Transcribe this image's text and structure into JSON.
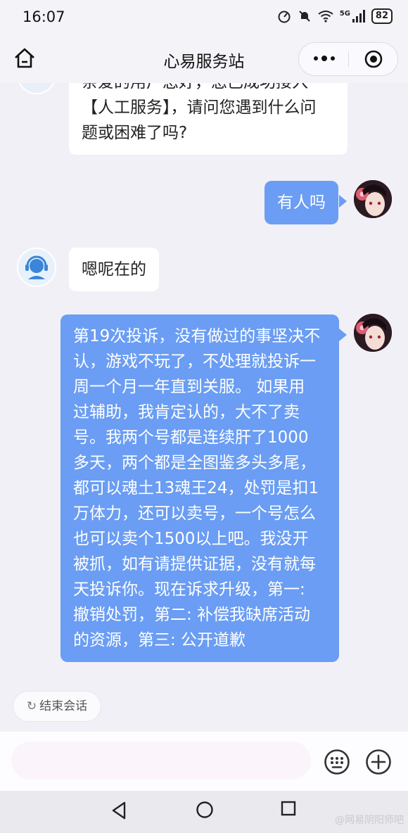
{
  "status_bar": {
    "time": "16:07",
    "battery": "82",
    "network": "5G"
  },
  "header": {
    "title": "心易服务站"
  },
  "messages": [
    {
      "from": "agent",
      "lines": [
        "亲爱的用户您好，您已成功接入",
        "【人工服务】，请问您遇到什么问",
        "题或困难了吗?"
      ]
    },
    {
      "from": "user",
      "lines": [
        "有人吗"
      ]
    },
    {
      "from": "agent",
      "lines": [
        "嗯呢在的"
      ]
    },
    {
      "from": "user",
      "lines": [
        "第19次投诉，没有做过的事坚决不",
        "认，游戏不玩了，不处理就投诉一",
        "周一个月一年直到关服。 如果用",
        "过辅助，我肯定认的，大不了卖",
        "号。我两个号都是连续肝了1000",
        "多天，两个都是全图鉴多头多尾，",
        "都可以魂土13魂王24，处罚是扣1",
        "万体力，还可以卖号，一个号怎么",
        "也可以卖个1500以上吧。我没开",
        "被抓，如有请提供证据，没有就每",
        "天投诉你。现在诉求升级，第一:",
        "撤销处罚，第二: 补偿我缺席活动",
        "的资源，第三: 公开道歉"
      ]
    }
  ],
  "end_session": {
    "label": "结束会话"
  },
  "input": {
    "value": "",
    "placeholder": ""
  },
  "watermark": "@网易阴阳师吧",
  "colors": {
    "user_bubble": "#6a9df3",
    "agent_bubble": "#ffffff",
    "background": "#f1f0f6"
  }
}
